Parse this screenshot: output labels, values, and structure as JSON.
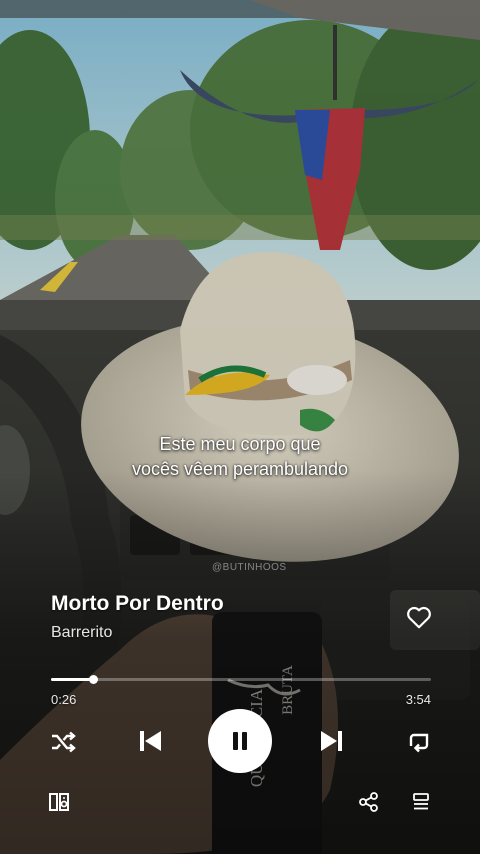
{
  "lyrics": {
    "line1": "Este meu corpo que",
    "line2": "vocês vêem perambulando"
  },
  "track": {
    "title": "Morto Por Dentro",
    "artist": "Barrerito",
    "liked": false
  },
  "playback": {
    "elapsed": "0:26",
    "total": "3:54",
    "progress_fraction": 0.11,
    "state": "playing"
  },
  "scene": {
    "watermark": "@BUTINHOOS",
    "box_text_top": "BRUTA",
    "box_text_bottom": "QUERÊNCIA"
  },
  "icons": {
    "like": "heart-outline-icon",
    "shuffle": "shuffle-icon",
    "prev": "skip-previous-icon",
    "play_pause": "pause-icon",
    "next": "skip-next-icon",
    "repeat": "repeat-icon",
    "devices": "connect-devices-icon",
    "share": "share-icon",
    "queue": "queue-icon"
  },
  "colors": {
    "text": "#ffffff",
    "play_button_bg": "#ffffff",
    "play_icon": "#111111"
  }
}
